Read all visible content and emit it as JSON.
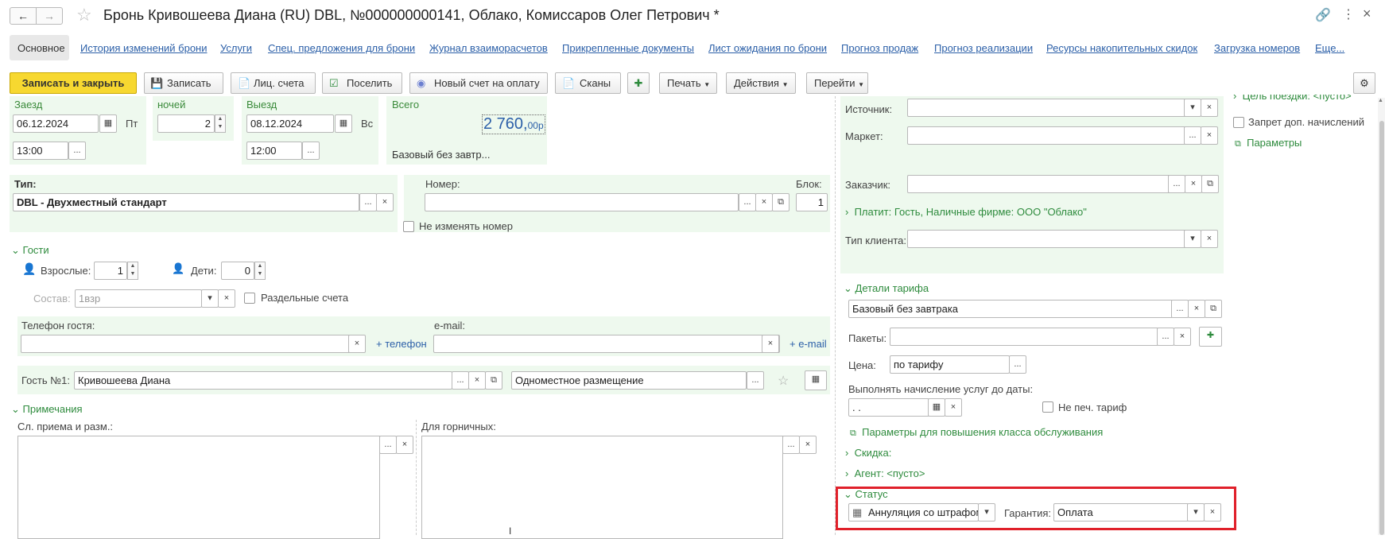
{
  "header": {
    "title": "Бронь Кривошеева Диана (RU) DBL, №000000000141, Облако, Комиссаров Олег Петрович *"
  },
  "tabs": [
    "Основное",
    "История изменений брони",
    "Услуги",
    "Спец. предложения для брони",
    "Журнал взаиморасчетов",
    "Прикрепленные документы",
    "Лист ожидания по брони",
    "Прогноз продаж",
    "Прогноз реализации",
    "Ресурсы накопительных скидок",
    "Загрузка номеров",
    "Еще..."
  ],
  "toolbar": {
    "save_close": "Записать и закрыть",
    "save": "Записать",
    "accounts": "Лиц. счета",
    "checkin": "Поселить",
    "new_invoice": "Новый счет на оплату",
    "scans": "Сканы",
    "print": "Печать",
    "actions": "Действия",
    "goto": "Перейти"
  },
  "dates": {
    "arrival_label": "Заезд",
    "arrival_date": "06.12.2024",
    "arrival_day": "Пт",
    "arrival_time": "13:00",
    "nights_label": "ночей",
    "nights": "2",
    "departure_label": "Выезд",
    "departure_date": "08.12.2024",
    "departure_day": "Вс",
    "departure_time": "12:00",
    "total_label": "Всего",
    "total_int": "2 760,",
    "total_dec": "00",
    "total_cur": "р",
    "rate_short": "Базовый без завтр..."
  },
  "room": {
    "type_label": "Тип:",
    "type_value": "DBL - Двухместный стандарт",
    "number_label": "Номер:",
    "block_label": "Блок:",
    "block_value": "1",
    "keep_number": "Не изменять номер"
  },
  "guests": {
    "section": "Гости",
    "adults_label": "Взрослые:",
    "adults": "1",
    "children_label": "Дети:",
    "children": "0",
    "composition_label": "Состав:",
    "composition_value": "1взр",
    "separate_accounts": "Раздельные счета",
    "phone_label": "Телефон гостя:",
    "add_phone": "+ телефон",
    "email_label": "e-mail:",
    "add_email": "+ e-mail",
    "guest1_label": "Гость №1:",
    "guest1_name": "Кривошеева Диана",
    "guest1_accom": "Одноместное размещение"
  },
  "notes": {
    "section": "Примечания",
    "reception_label": "Сл. приема и разм.:",
    "housekeeping_label": "Для горничных:"
  },
  "right": {
    "source_label": "Источник:",
    "market_label": "Маркет:",
    "customer_label": "Заказчик:",
    "payer": "Платит: Гость, Наличные фирме: ООО \"Облако\"",
    "client_type_label": "Тип клиента:",
    "tariff_section": "Детали тарифа",
    "tariff_value": "Базовый без завтрака",
    "packages_label": "Пакеты:",
    "price_label": "Цена:",
    "price_value": "по тарифу",
    "charge_until_label": "Выполнять начисление услуг до даты:",
    "charge_until_value": " .  .",
    "no_print_tariff": "Не печ. тариф",
    "upgrade_params": "Параметры для повышения класса обслуживания",
    "discount": "Скидка:",
    "agent": "Агент: <пусто>",
    "status_section": "Статус",
    "status_value": "Аннуляция со штрафом",
    "guarantee_label": "Гарантия:",
    "guarantee_value": "Оплата"
  },
  "far_right": {
    "trip_purpose": "Цель поездки: <пусто>",
    "no_extra_charges": "Запрет доп. начислений",
    "params": "Параметры"
  },
  "colors": {
    "accent_yellow": "#f7d830",
    "link_blue": "#2b5fa8",
    "section_green": "#2e8b3d",
    "highlight_red": "#e0202a"
  }
}
